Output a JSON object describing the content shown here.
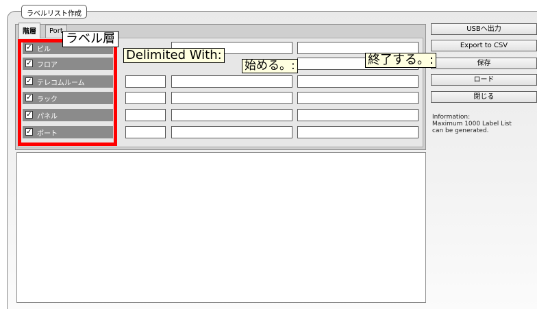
{
  "window": {
    "title": "ラベルリスト作成"
  },
  "tabs": [
    {
      "label": "階層"
    },
    {
      "label": "Port"
    }
  ],
  "layers": [
    {
      "label": "ビル",
      "checked": true
    },
    {
      "label": "フロア",
      "checked": true
    },
    {
      "label": "テレコムルーム",
      "checked": true
    },
    {
      "label": "ラック",
      "checked": true
    },
    {
      "label": "パネル",
      "checked": true
    },
    {
      "label": "ポート",
      "checked": true
    }
  ],
  "buttons": {
    "usb_output": "USBへ出力",
    "export_csv": "Export to CSV",
    "save": "保存",
    "load": "ロード",
    "close": "閉じる"
  },
  "info": {
    "heading": "Information:",
    "line1": "Maximum 1000 Label List",
    "line2": "can be generated."
  },
  "callouts": {
    "label_layer": "ラベル層",
    "delimited_with": "Delimited With:",
    "start": "始める。:",
    "end": "終了する。:"
  },
  "colors": {
    "highlight": "#ff0000",
    "row_bg": "#8b8b8b"
  }
}
